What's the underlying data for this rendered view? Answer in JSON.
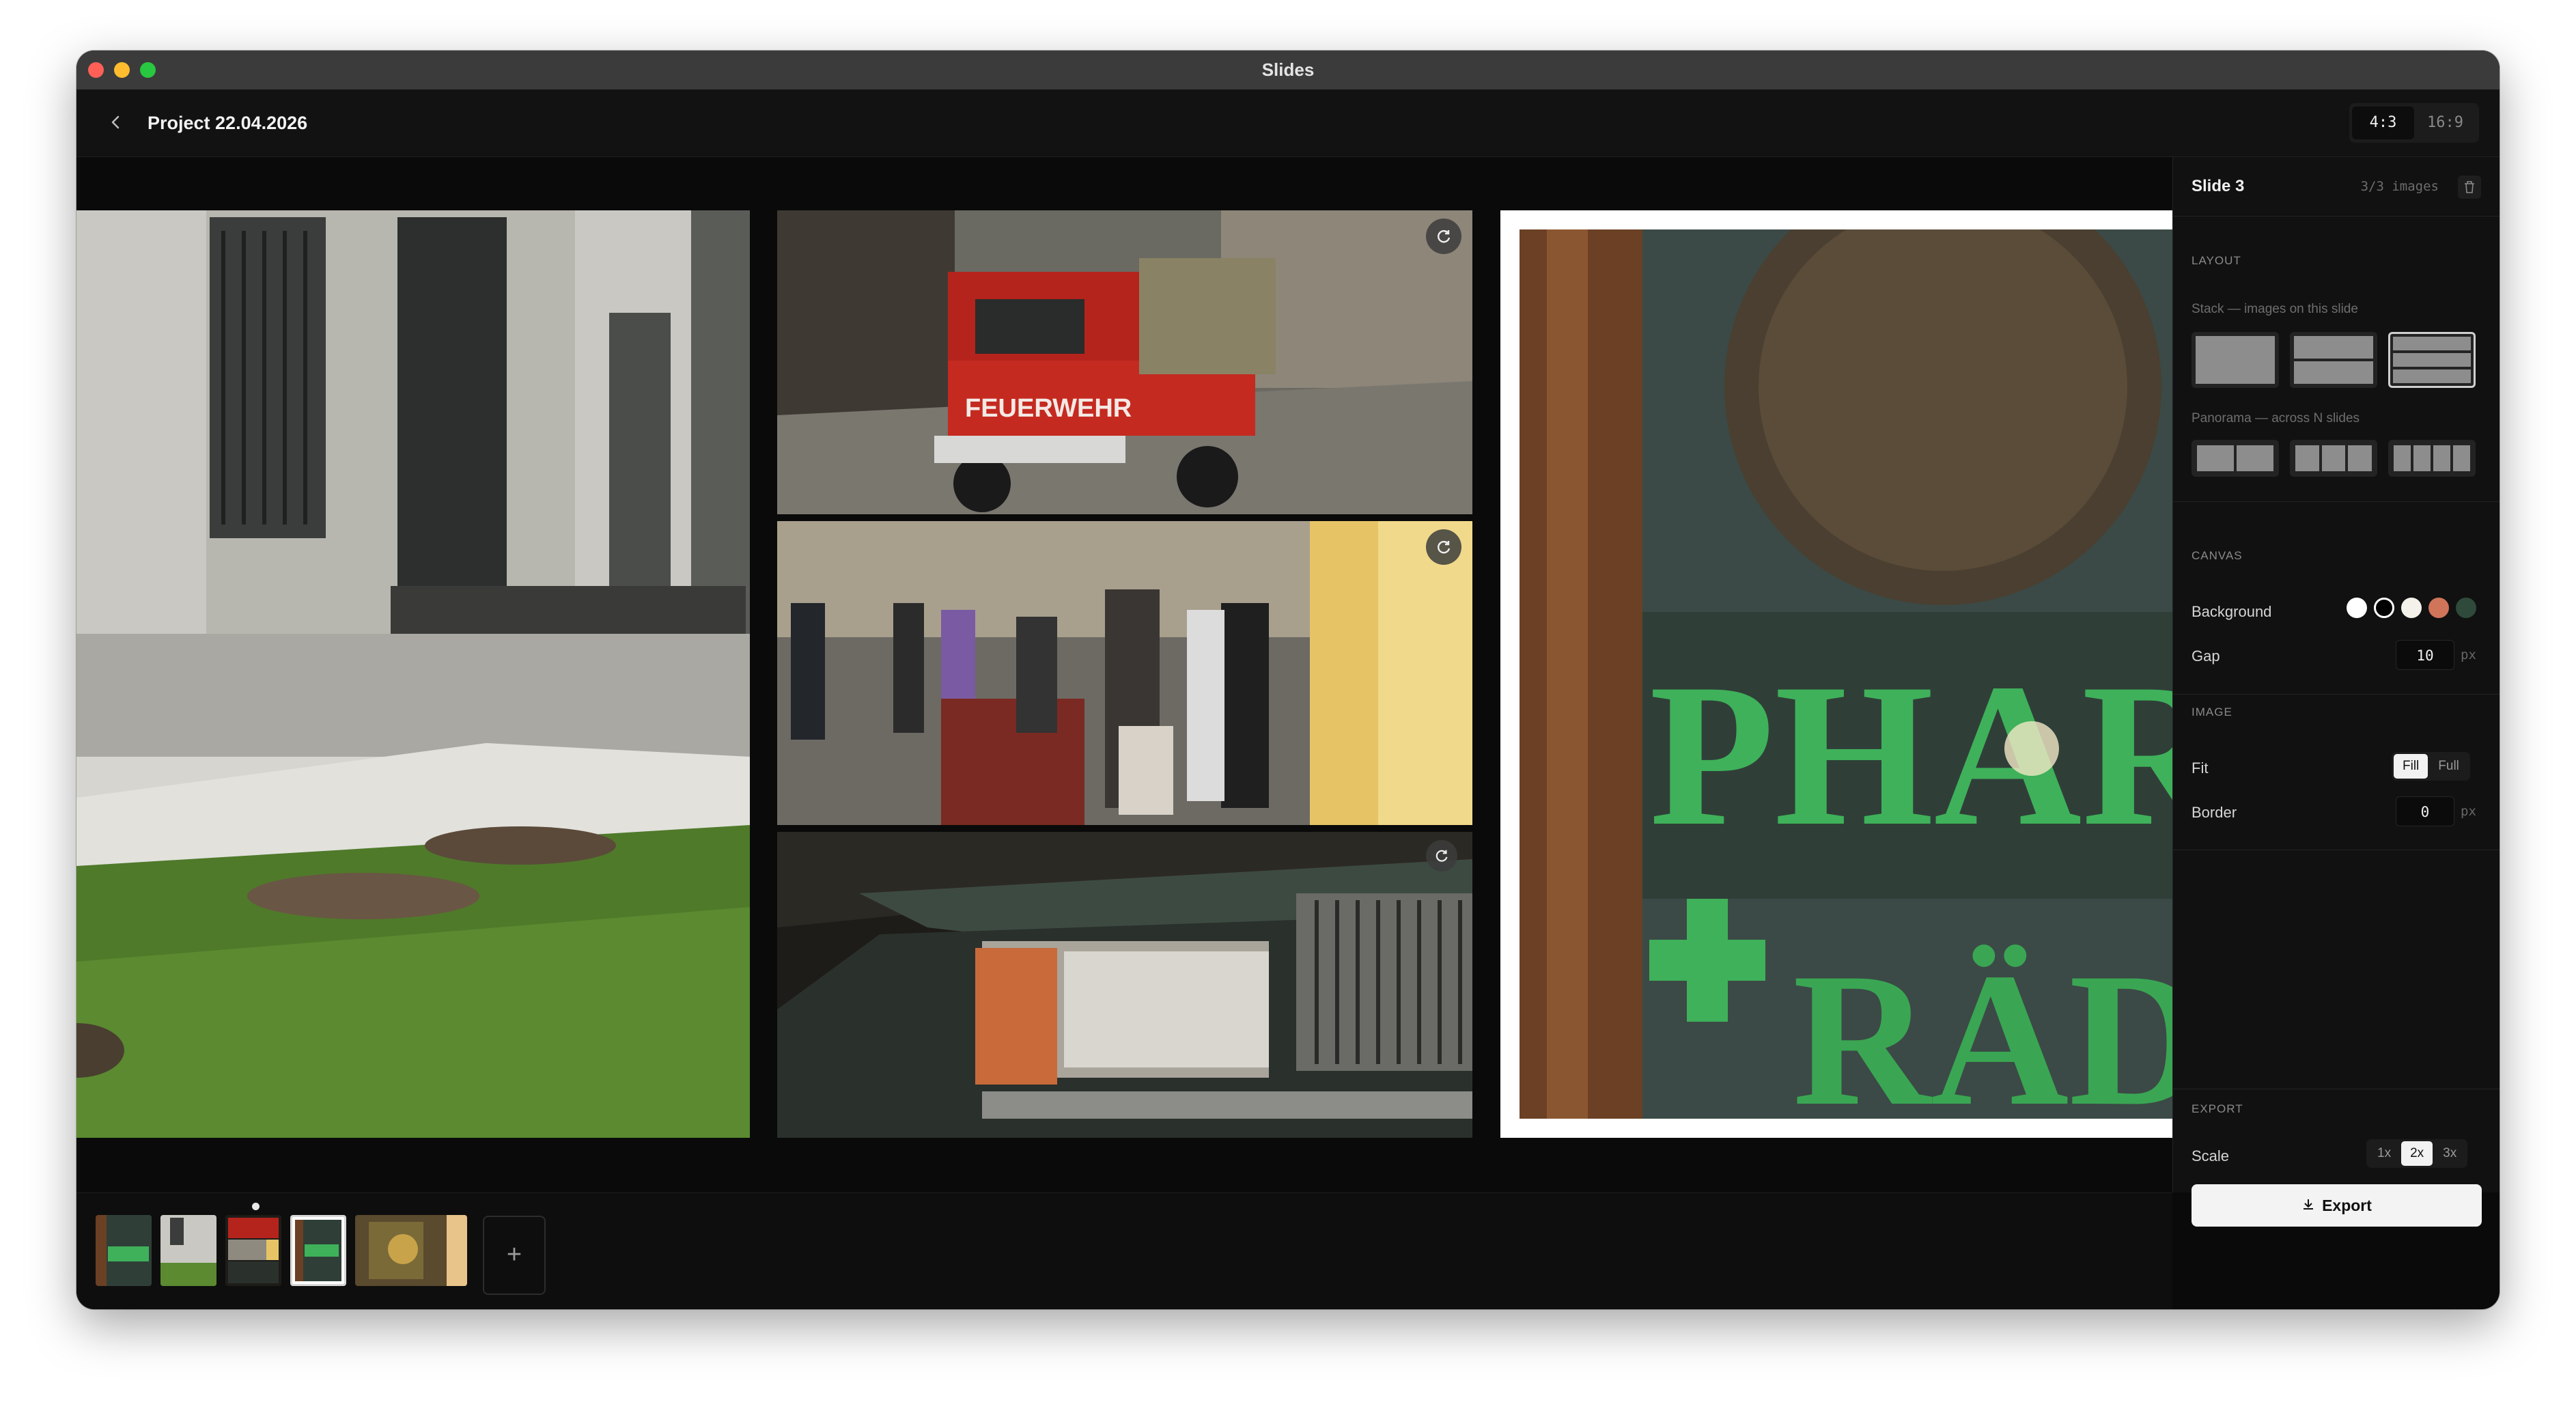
{
  "window": {
    "title": "Slides"
  },
  "header": {
    "back_icon": "chevron-left-icon",
    "project_title": "Project 22.04.2026"
  },
  "aspect_ratio": {
    "options": [
      "4:3",
      "16:9"
    ],
    "selected": "4:3"
  },
  "canvas": {
    "images": [
      {
        "name": "building-with-lawn",
        "description_icon": "photo"
      },
      {
        "name": "red-fire-truck",
        "text": "FEUERWEHR"
      },
      {
        "name": "crowd-on-cobblestone-street"
      },
      {
        "name": "car-headlight"
      },
      {
        "name": "pharmacy-sign",
        "text": "PHARM"
      }
    ],
    "refresh_icon": "refresh-icon"
  },
  "panel": {
    "slide_title": "Slide 3",
    "image_count": "3/3 images",
    "delete_icon": "trash-icon",
    "layout": {
      "heading": "LAYOUT",
      "stack_label": "Stack — images on this slide",
      "panorama_label": "Panorama — across N slides"
    },
    "canvas": {
      "heading": "CANVAS",
      "background_label": "Background",
      "swatches": [
        "#ffffff",
        "#000000",
        "#f4f1ea",
        "#d0745a",
        "#2f4a3a"
      ],
      "gap_label": "Gap",
      "gap_value": "10",
      "gap_unit": "px"
    },
    "image": {
      "heading": "IMAGE",
      "fit_label": "Fit",
      "fit_options": [
        "Fill",
        "Full"
      ],
      "fit_selected": "Fill",
      "border_label": "Border",
      "border_value": "0",
      "border_unit": "px"
    },
    "export": {
      "heading": "EXPORT",
      "scale_label": "Scale",
      "scale_options": [
        "1x",
        "2x",
        "3x"
      ],
      "scale_selected": "2x",
      "button_label": "Export",
      "button_icon": "download-icon"
    }
  },
  "filmstrip": {
    "add_label": "+",
    "thumbnails": [
      "slide-1",
      "slide-2",
      "slide-3",
      "slide-4",
      "slide-5"
    ],
    "selected_index": 3
  }
}
